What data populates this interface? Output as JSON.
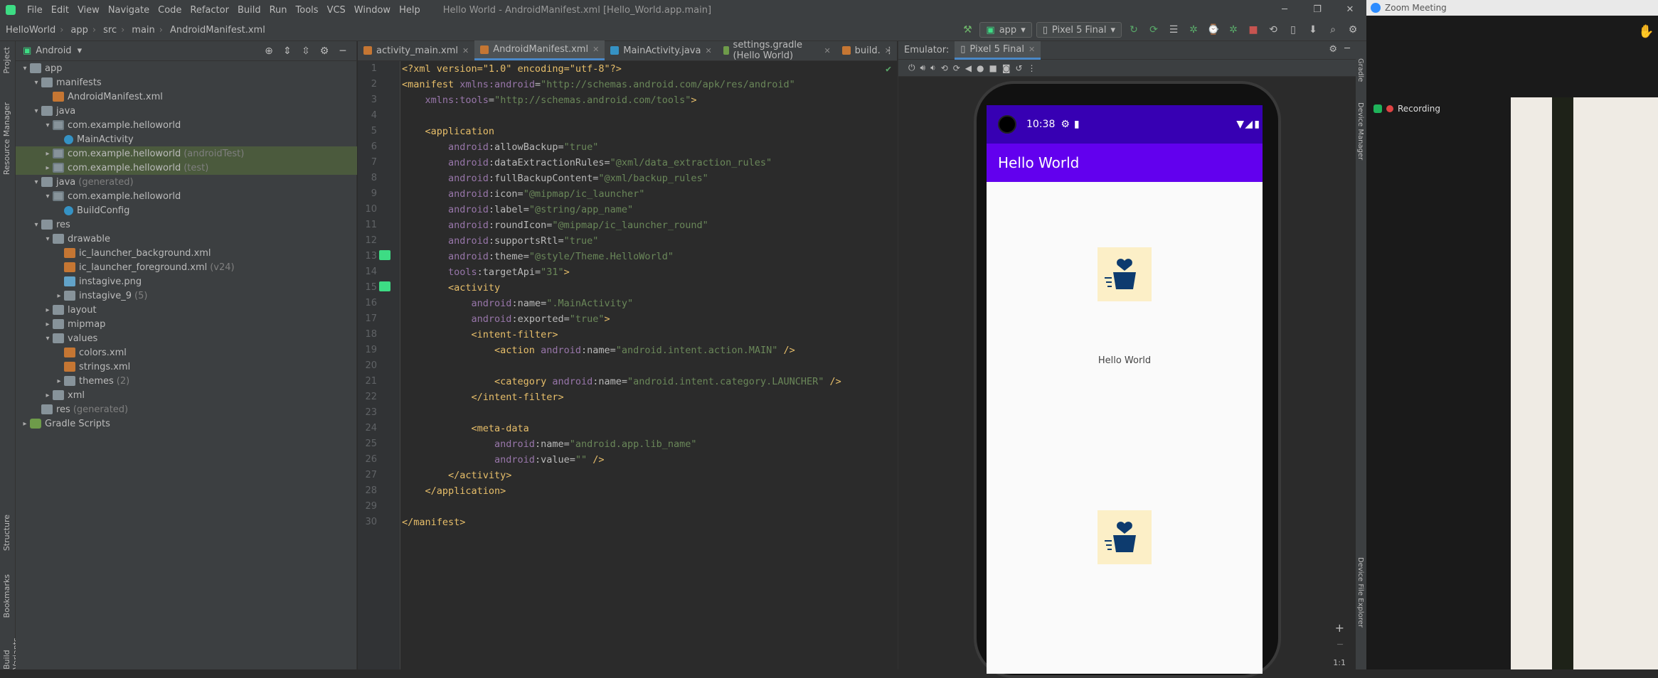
{
  "ide": {
    "menu": [
      "File",
      "Edit",
      "View",
      "Navigate",
      "Code",
      "Refactor",
      "Build",
      "Run",
      "Tools",
      "VCS",
      "Window",
      "Help"
    ],
    "window_title": "Hello World - AndroidManifest.xml [Hello_World.app.main]",
    "breadcrumbs": [
      "HelloWorld",
      "app",
      "src",
      "main",
      "AndroidManifest.xml"
    ],
    "run_config": "app",
    "device": "Pixel 5 Final"
  },
  "sidebar": {
    "strip_project": "Project",
    "strip_resource_manager": "Resource Manager",
    "strip_structure": "Structure",
    "strip_bookmarks": "Bookmarks",
    "strip_variants": "Build Variants"
  },
  "project": {
    "view_mode": "Android",
    "tree": [
      {
        "label": "app",
        "icon": "folder",
        "indent": 0,
        "arrow": "▾"
      },
      {
        "label": "manifests",
        "icon": "folder",
        "indent": 1,
        "arrow": "▾"
      },
      {
        "label": "AndroidManifest.xml",
        "icon": "xml",
        "indent": 2,
        "arrow": ""
      },
      {
        "label": "java",
        "icon": "folder",
        "indent": 1,
        "arrow": "▾"
      },
      {
        "label": "com.example.helloworld",
        "icon": "pkg",
        "indent": 2,
        "arrow": "▾"
      },
      {
        "label": "MainActivity",
        "icon": "cls",
        "indent": 3,
        "arrow": ""
      },
      {
        "label": "com.example.helloworld",
        "icon": "pkg",
        "indent": 2,
        "arrow": "▸",
        "hint": "(androidTest)",
        "sel": true
      },
      {
        "label": "com.example.helloworld",
        "icon": "pkg",
        "indent": 2,
        "arrow": "▸",
        "hint": "(test)",
        "sel": true
      },
      {
        "label": "java",
        "icon": "folder",
        "indent": 1,
        "arrow": "▾",
        "hint": "(generated)"
      },
      {
        "label": "com.example.helloworld",
        "icon": "pkg",
        "indent": 2,
        "arrow": "▾"
      },
      {
        "label": "BuildConfig",
        "icon": "cls",
        "indent": 3,
        "arrow": ""
      },
      {
        "label": "res",
        "icon": "folder",
        "indent": 1,
        "arrow": "▾"
      },
      {
        "label": "drawable",
        "icon": "folder",
        "indent": 2,
        "arrow": "▾"
      },
      {
        "label": "ic_launcher_background.xml",
        "icon": "xml",
        "indent": 3,
        "arrow": ""
      },
      {
        "label": "ic_launcher_foreground.xml",
        "icon": "xml",
        "indent": 3,
        "arrow": "",
        "hint": "(v24)"
      },
      {
        "label": "instagive.png",
        "icon": "png",
        "indent": 3,
        "arrow": ""
      },
      {
        "label": "instagive_9",
        "icon": "folder",
        "indent": 3,
        "arrow": "▸",
        "hint": "(5)"
      },
      {
        "label": "layout",
        "icon": "folder",
        "indent": 2,
        "arrow": "▸"
      },
      {
        "label": "mipmap",
        "icon": "folder",
        "indent": 2,
        "arrow": "▸"
      },
      {
        "label": "values",
        "icon": "folder",
        "indent": 2,
        "arrow": "▾"
      },
      {
        "label": "colors.xml",
        "icon": "xml",
        "indent": 3,
        "arrow": ""
      },
      {
        "label": "strings.xml",
        "icon": "xml",
        "indent": 3,
        "arrow": ""
      },
      {
        "label": "themes",
        "icon": "folder",
        "indent": 3,
        "arrow": "▸",
        "hint": "(2)"
      },
      {
        "label": "xml",
        "icon": "folder",
        "indent": 2,
        "arrow": "▸"
      },
      {
        "label": "res",
        "icon": "folder",
        "indent": 1,
        "arrow": "",
        "hint": "(generated)"
      },
      {
        "label": "Gradle Scripts",
        "icon": "gradle",
        "indent": 0,
        "arrow": "▸"
      }
    ]
  },
  "editor": {
    "tabs": [
      {
        "label": "activity_main.xml",
        "active": false
      },
      {
        "label": "AndroidManifest.xml",
        "active": true
      },
      {
        "label": "MainActivity.java",
        "active": false
      },
      {
        "label": "settings.gradle (Hello World)",
        "active": false
      },
      {
        "label": "build.",
        "active": false
      }
    ],
    "lines": [
      [
        [
          "pi",
          "<?xml version=\"1.0\" encoding=\"utf-8\"?>"
        ]
      ],
      [
        [
          "tag",
          "<manifest "
        ],
        [
          "ns",
          "xmlns:android"
        ],
        [
          "attr",
          "="
        ],
        [
          "val",
          "\"http://schemas.android.com/apk/res/android\""
        ]
      ],
      [
        [
          "attr",
          "    "
        ],
        [
          "ns",
          "xmlns:tools"
        ],
        [
          "attr",
          "="
        ],
        [
          "val",
          "\"http://schemas.android.com/tools\""
        ],
        [
          "tag",
          ">"
        ]
      ],
      [],
      [
        [
          "tag",
          "    <application"
        ]
      ],
      [
        [
          "ns",
          "        android"
        ],
        [
          "attr",
          ":allowBackup="
        ],
        [
          "val",
          "\"true\""
        ]
      ],
      [
        [
          "ns",
          "        android"
        ],
        [
          "attr",
          ":dataExtractionRules="
        ],
        [
          "val",
          "\"@xml/data_extraction_rules\""
        ]
      ],
      [
        [
          "ns",
          "        android"
        ],
        [
          "attr",
          ":fullBackupContent="
        ],
        [
          "val",
          "\"@xml/backup_rules\""
        ]
      ],
      [
        [
          "ns",
          "        android"
        ],
        [
          "attr",
          ":icon="
        ],
        [
          "val",
          "\"@mipmap/ic_launcher\""
        ]
      ],
      [
        [
          "ns",
          "        android"
        ],
        [
          "attr",
          ":label="
        ],
        [
          "val",
          "\"@string/app_name\""
        ]
      ],
      [
        [
          "ns",
          "        android"
        ],
        [
          "attr",
          ":roundIcon="
        ],
        [
          "val",
          "\"@mipmap/ic_launcher_round\""
        ]
      ],
      [
        [
          "ns",
          "        android"
        ],
        [
          "attr",
          ":supportsRtl="
        ],
        [
          "val",
          "\"true\""
        ]
      ],
      [
        [
          "ns",
          "        android"
        ],
        [
          "attr",
          ":theme="
        ],
        [
          "val",
          "\"@style/Theme.HelloWorld\""
        ]
      ],
      [
        [
          "ns",
          "        tools"
        ],
        [
          "attr",
          ":targetApi="
        ],
        [
          "val",
          "\"31\""
        ],
        [
          "tag",
          ">"
        ]
      ],
      [
        [
          "tag",
          "        <activity"
        ]
      ],
      [
        [
          "ns",
          "            android"
        ],
        [
          "attr",
          ":name="
        ],
        [
          "val",
          "\".MainActivity\""
        ]
      ],
      [
        [
          "ns",
          "            android"
        ],
        [
          "attr",
          ":exported="
        ],
        [
          "val",
          "\"true\""
        ],
        [
          "tag",
          ">"
        ]
      ],
      [
        [
          "tag",
          "            <intent-filter>"
        ]
      ],
      [
        [
          "tag",
          "                <action "
        ],
        [
          "ns",
          "android"
        ],
        [
          "attr",
          ":name="
        ],
        [
          "val",
          "\"android.intent.action.MAIN\""
        ],
        [
          "tag",
          " />"
        ]
      ],
      [],
      [
        [
          "tag",
          "                <category "
        ],
        [
          "ns",
          "android"
        ],
        [
          "attr",
          ":name="
        ],
        [
          "val",
          "\"android.intent.category.LAUNCHER\""
        ],
        [
          "tag",
          " />"
        ]
      ],
      [
        [
          "tag",
          "            </intent-filter>"
        ]
      ],
      [],
      [
        [
          "tag",
          "            <meta-data"
        ]
      ],
      [
        [
          "ns",
          "                android"
        ],
        [
          "attr",
          ":name="
        ],
        [
          "val",
          "\"android.app.lib_name\""
        ]
      ],
      [
        [
          "ns",
          "                android"
        ],
        [
          "attr",
          ":value="
        ],
        [
          "val",
          "\"\""
        ],
        [
          "tag",
          " />"
        ]
      ],
      [
        [
          "tag",
          "        </activity>"
        ]
      ],
      [
        [
          "tag",
          "    </application>"
        ]
      ],
      [],
      [
        [
          "tag",
          "</manifest>"
        ]
      ]
    ]
  },
  "emulator": {
    "label": "Emulator:",
    "device_tab": "Pixel 5 Final",
    "time": "10:38",
    "app_title": "Hello World",
    "hello_text": "Hello World",
    "zoom_ratio": "1:1"
  },
  "right_strip": {
    "gradle": "Gradle",
    "device_manager": "Device Manager",
    "file_explorer": "Device File Explorer"
  },
  "zoom": {
    "title": "Zoom Meeting",
    "recording": "Recording"
  }
}
